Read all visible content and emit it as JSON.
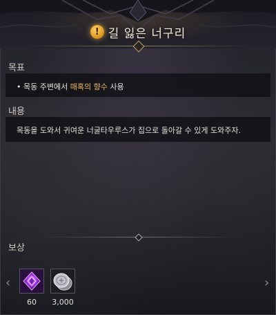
{
  "quest": {
    "title": "길 잃은 너구리",
    "icon": "quest-exclamation-icon",
    "title_icon_glyph": "!"
  },
  "goal": {
    "label": "목표",
    "bullet": "•",
    "text_before": "목동 주변에서",
    "item_name": "매혹의 향수",
    "text_after": "사용"
  },
  "description": {
    "label": "내용",
    "text": "목동을 도와서 귀여운 너굴타우루스가 집으로 돌아갈 수 있게 도와주자."
  },
  "rewards": {
    "label": "보상",
    "prev_arrow": "‹",
    "next_arrow": "›",
    "items": [
      {
        "icon": "purple-crystal-icon",
        "count": "60"
      },
      {
        "icon": "silver-coin-icon",
        "count": "3,000"
      }
    ]
  },
  "colors": {
    "highlight": "#e9b864",
    "title_icon": "#e0a030"
  }
}
